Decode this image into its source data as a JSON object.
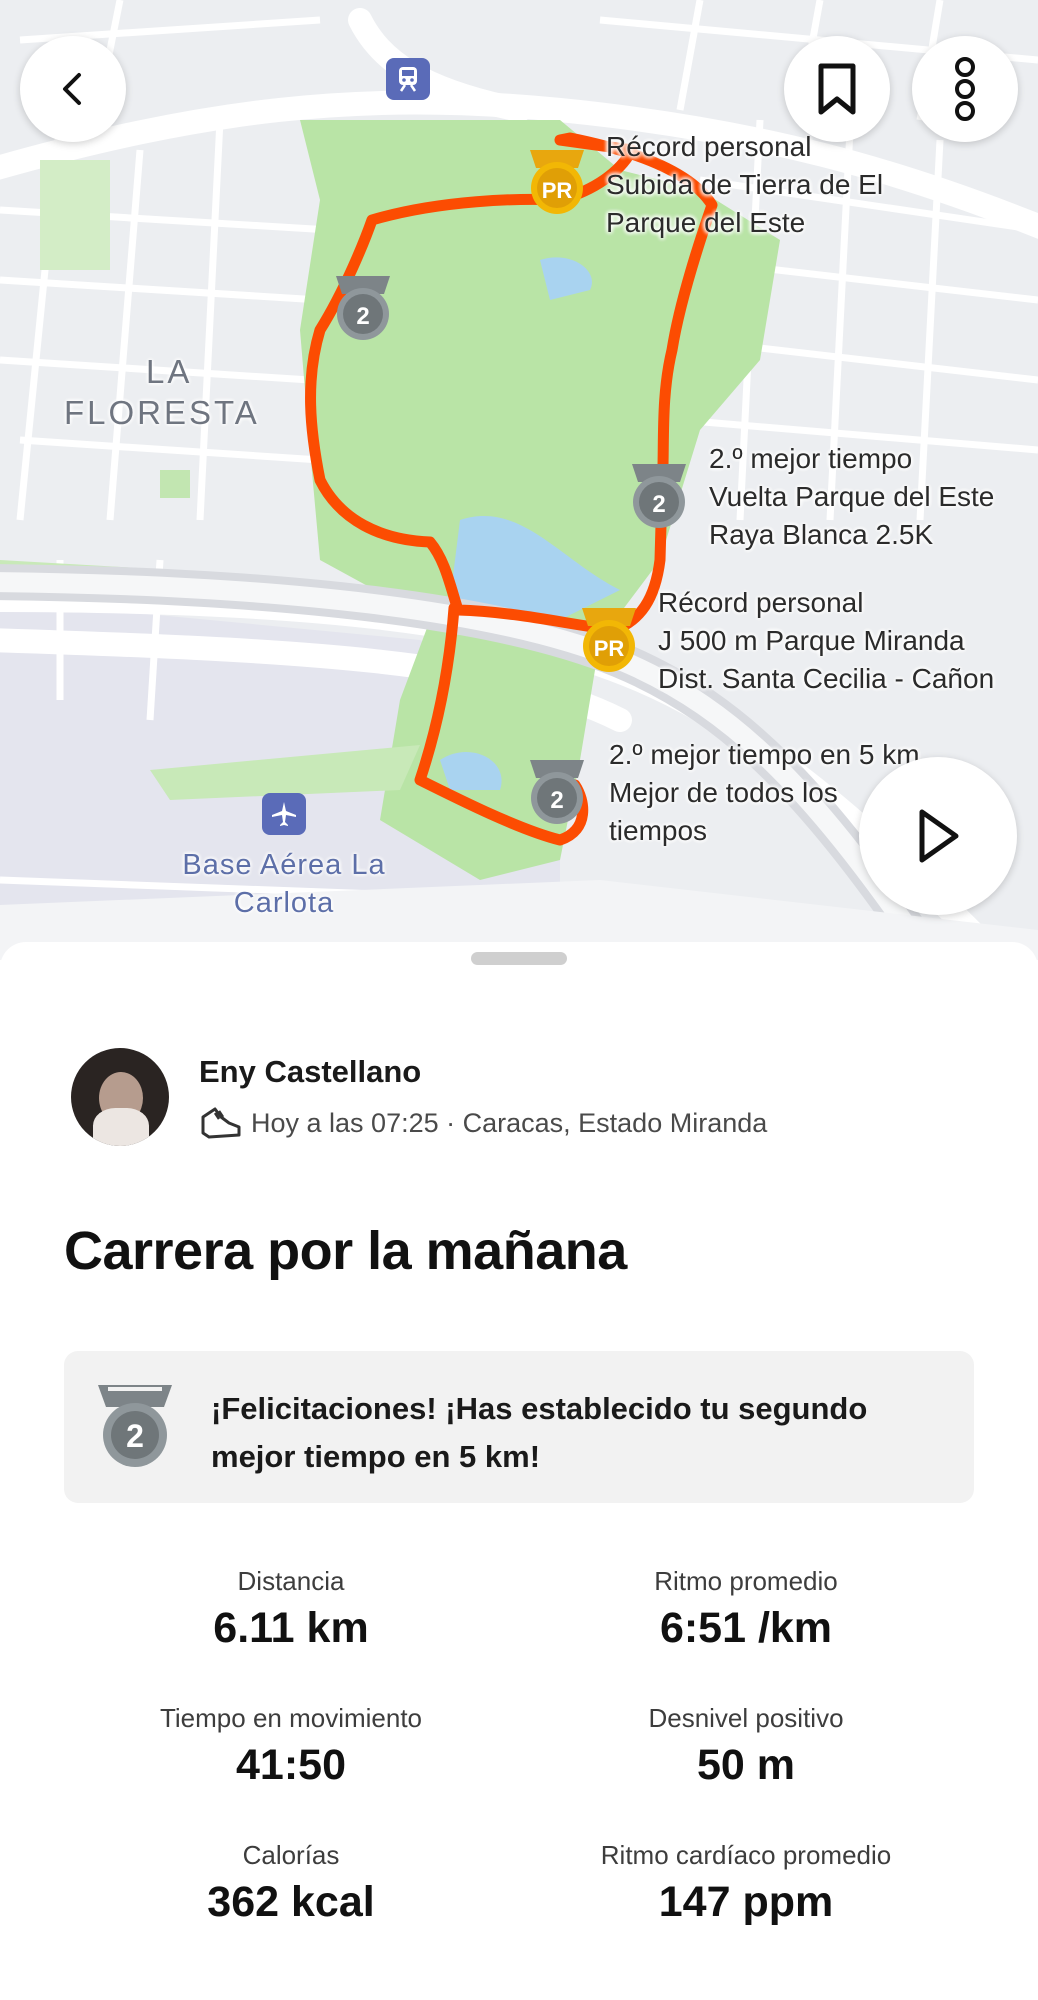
{
  "map": {
    "area_labels": {
      "la_floresta_1": "LA",
      "la_floresta_2": "FLORESTA",
      "base_aerea_1": "Base Aérea La",
      "base_aerea_2": "Carlota"
    },
    "segments": [
      {
        "line1": "Récord personal",
        "line2": "Subida de Tierra de El",
        "line3": "Parque del Este"
      },
      {
        "line1": "2.º mejor tiempo",
        "line2": "Vuelta Parque del Este",
        "line3": "Raya Blanca 2.5K"
      },
      {
        "line1": "Récord personal",
        "line2": "J 500 m Parque Miranda",
        "line3": "Dist. Santa Cecilia - Cañon"
      },
      {
        "line1": "2.º mejor tiempo en 5 km",
        "line2": "Mejor de todos los",
        "line3": "tiempos"
      }
    ],
    "badges": {
      "pr": "PR",
      "second": "2"
    },
    "route_color": "#fc4c02",
    "park_color": "#b6e3a4"
  },
  "toolbar": {
    "back_icon": "chevron-left-icon",
    "bookmark_icon": "bookmark-icon",
    "more_icon": "more-vertical-icon",
    "play_icon": "play-icon"
  },
  "activity": {
    "athlete_name": "Eny Castellano",
    "meta": "Hoy a las 07:25 · Caracas, Estado Miranda",
    "title": "Carrera por la mañana",
    "achievement": "¡Felicitaciones! ¡Has establecido tu segundo mejor tiempo en 5 km!",
    "achievement_medal": "2"
  },
  "stats": [
    {
      "label": "Distancia",
      "value": "6.11 km"
    },
    {
      "label": "Ritmo promedio",
      "value": "6:51 /km"
    },
    {
      "label": "Tiempo en movimiento",
      "value": "41:50"
    },
    {
      "label": "Desnivel positivo",
      "value": "50 m"
    },
    {
      "label": "Calorías",
      "value": "362 kcal"
    },
    {
      "label": "Ritmo cardíaco promedio",
      "value": "147 ppm"
    }
  ]
}
